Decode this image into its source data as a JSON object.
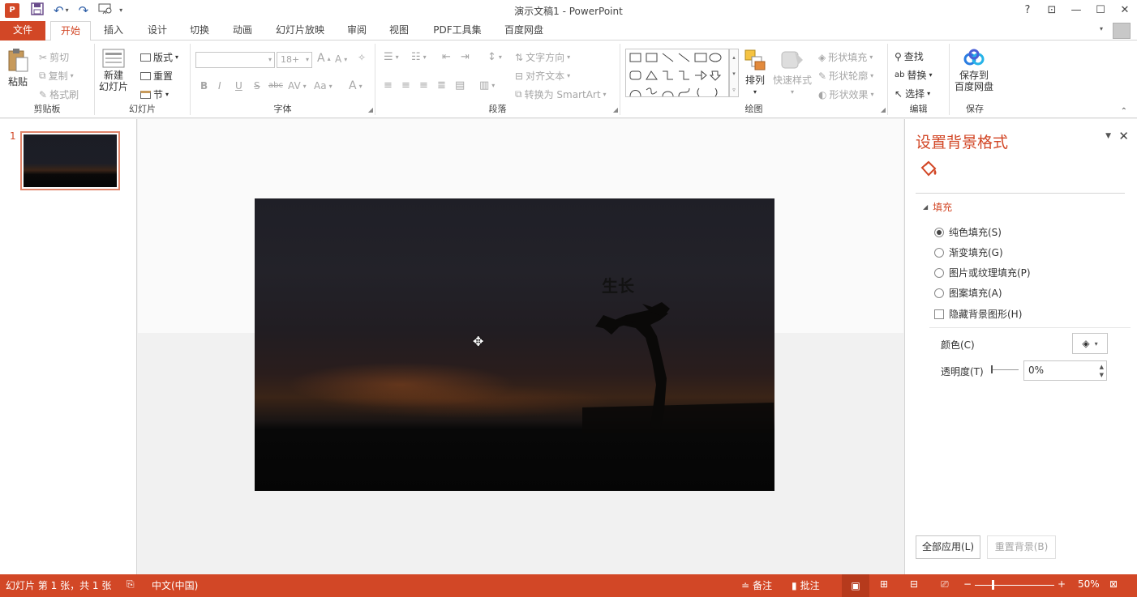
{
  "app": {
    "title": "演示文稿1 - PowerPoint",
    "help": "?"
  },
  "tabs": [
    "文件",
    "开始",
    "插入",
    "设计",
    "切换",
    "动画",
    "幻灯片放映",
    "审阅",
    "视图",
    "PDF工具集",
    "百度网盘"
  ],
  "ribbon": {
    "clipboard": {
      "label": "剪贴板",
      "paste": "粘贴",
      "cut": "剪切",
      "copy": "复制",
      "format_painter": "格式刷"
    },
    "slides": {
      "label": "幻灯片",
      "new_slide_1": "新建",
      "new_slide_2": "幻灯片",
      "layout": "版式",
      "reset": "重置",
      "section": "节"
    },
    "font": {
      "label": "字体",
      "font_size": "18+",
      "bold": "B",
      "italic": "I",
      "underline": "U",
      "shadow": "S",
      "strike": "abc",
      "spacing": "AV",
      "case": "Aa",
      "grow": "A",
      "shrink": "A",
      "color": "A"
    },
    "paragraph": {
      "label": "段落",
      "text_direction": "文字方向",
      "align_text": "对齐文本",
      "smartart": "转换为 SmartArt"
    },
    "drawing": {
      "label": "绘图",
      "arrange": "排列",
      "quick_styles": "快速样式",
      "shape_fill": "形状填充",
      "shape_outline": "形状轮廓",
      "shape_effects": "形状效果"
    },
    "editing": {
      "label": "编辑",
      "find": "查找",
      "replace": "替换",
      "select": "选择"
    },
    "save": {
      "label": "保存",
      "save_to_1": "保存到",
      "save_to_2": "百度网盘"
    }
  },
  "thumbnails": {
    "slide_number": "1"
  },
  "slide": {
    "text": "生长"
  },
  "format_pane": {
    "title": "设置背景格式",
    "section": "填充",
    "options": [
      "纯色填充(S)",
      "渐变填充(G)",
      "图片或纹理填充(P)",
      "图案填充(A)"
    ],
    "selected_option": "纯色填充(S)",
    "hide_bg": "隐藏背景图形(H)",
    "color_label": "颜色(C)",
    "transparency_label": "透明度(T)",
    "transparency_value": "0%",
    "transparency_level": 0,
    "apply_all": "全部应用(L)",
    "reset_bg": "重置背景(B)"
  },
  "statusbar": {
    "slide_info": "幻灯片 第 1 张，共 1 张",
    "language": "中文(中国)",
    "notes": "备注",
    "comments": "批注",
    "zoom": "50%"
  },
  "colors": {
    "accent": "#d24726"
  }
}
